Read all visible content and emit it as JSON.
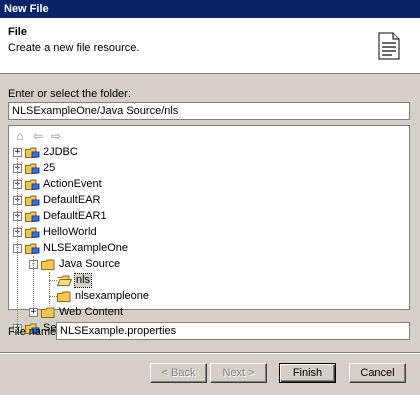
{
  "window": {
    "title": "New File"
  },
  "banner": {
    "title": "File",
    "description": "Create a new file resource."
  },
  "folder": {
    "label": "Enter or select the folder:",
    "value": "NLSExampleOne/Java Source/nls"
  },
  "tree": {
    "items": [
      {
        "label": "2JDBC",
        "expander": "+"
      },
      {
        "label": "25",
        "expander": "+"
      },
      {
        "label": "ActionEvent",
        "expander": "+"
      },
      {
        "label": "DefaultEAR",
        "expander": "+"
      },
      {
        "label": "DefaultEAR1",
        "expander": "+"
      },
      {
        "label": "HelloWorld",
        "expander": "+"
      },
      {
        "label": "NLSExampleOne",
        "expander": "-"
      },
      {
        "label": "Java Source",
        "expander": "-"
      },
      {
        "label": "nls",
        "expander": ""
      },
      {
        "label": "nlsexampleone",
        "expander": ""
      },
      {
        "label": "Web Content",
        "expander": "+"
      },
      {
        "label": "Servers",
        "expander": "+"
      }
    ],
    "selected": "nls"
  },
  "filename": {
    "label": "File name:",
    "value": "NLSExample.properties"
  },
  "buttons": {
    "back": "< Back",
    "next": "Next >",
    "finish": "Finish",
    "cancel": "Cancel"
  },
  "colors": {
    "titlebar": "#0a246a",
    "folder": "#f0c850",
    "project": "#3a6fd8"
  }
}
